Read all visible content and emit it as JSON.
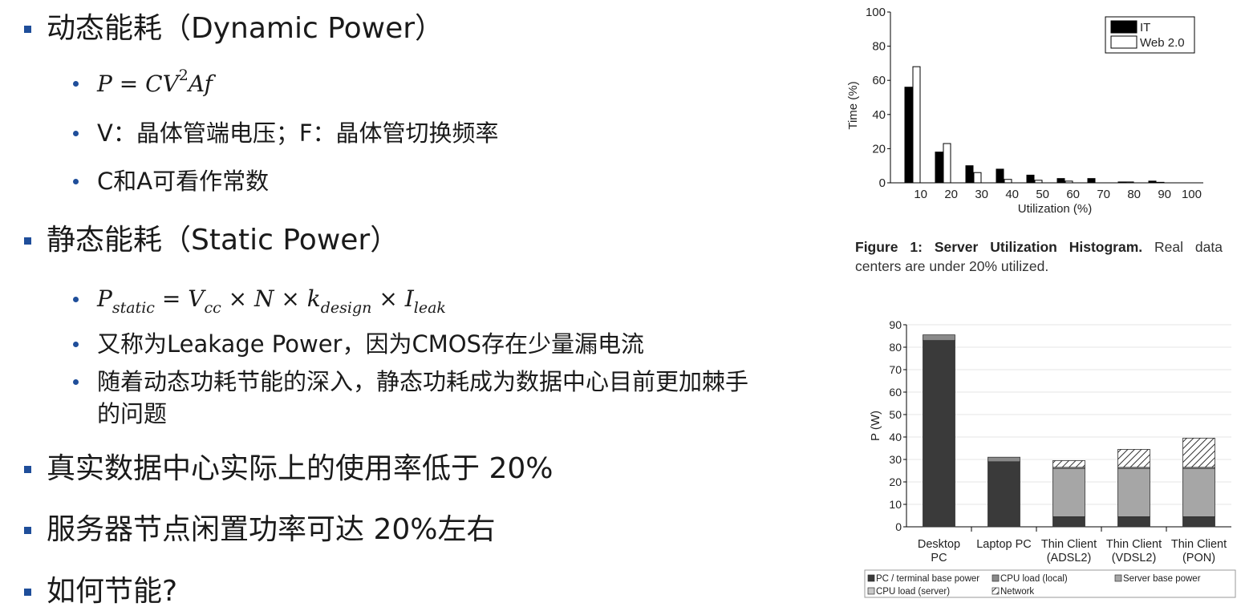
{
  "slide": {
    "items": [
      {
        "level": 1,
        "text": "动态能耗（Dynamic Power）"
      },
      {
        "level": 2,
        "kind": "formula",
        "parts": {
          "p": "P",
          "eq": "=",
          "c": "C",
          "v": "V",
          "exp": "2",
          "a": "A",
          "f": "f"
        }
      },
      {
        "level": 2,
        "text": "V：晶体管端电压；F：晶体管切换频率"
      },
      {
        "level": 2,
        "text": "C和A可看作常数"
      },
      {
        "level": 1,
        "text": "静态能耗（Static Power）"
      },
      {
        "level": 2,
        "kind": "formula",
        "parts": {
          "p": "P",
          "p_sub": "static",
          "eq": "=",
          "v": "V",
          "v_sub": "cc",
          "times": "×",
          "n": "N",
          "k": "k",
          "k_sub": "design",
          "i": "I",
          "i_sub": "leak"
        }
      },
      {
        "level": 2,
        "text": "又称为Leakage Power，因为CMOS存在少量漏电流"
      },
      {
        "level": 2,
        "text": "随着动态功耗节能的深入，静态功耗成为数据中心目前更加棘手",
        "text2": "的问题"
      },
      {
        "level": 1,
        "text": "真实数据中心实际上的使用率低于 20%"
      },
      {
        "level": 1,
        "text": "服务器节点闲置功率可达 20%左右"
      },
      {
        "level": 1,
        "text": "如何节能?"
      }
    ]
  },
  "figure_caption": {
    "label": "Figure 1:",
    "title": "Server Utilization Histogram.",
    "body": "Real data centers are under 20% utilized."
  },
  "colors": {
    "bullet": "#1f4e9a",
    "it": "#000000",
    "web": "#ffffff",
    "pc_base": "#3a3a3a",
    "cpu_local": "#8a8a8a",
    "server_base": "#a6a6a6",
    "cpu_server": "#c8c8c8"
  },
  "chart_data": [
    {
      "type": "bar",
      "categories": [
        "10",
        "20",
        "30",
        "40",
        "50",
        "60",
        "70",
        "80",
        "90",
        "100"
      ],
      "series": [
        {
          "name": "IT",
          "values": [
            56,
            18,
            10,
            8,
            4.5,
            2.5,
            2.5,
            0.5,
            1,
            0
          ]
        },
        {
          "name": "Web 2.0",
          "values": [
            68,
            23,
            6,
            2,
            1.5,
            1,
            0,
            0.5,
            0.3,
            0
          ]
        }
      ],
      "xlabel": "Utilization (%)",
      "ylabel": "Time (%)",
      "ylim": [
        0,
        100
      ],
      "yticks": [
        0,
        20,
        40,
        60,
        80,
        100
      ],
      "legend": "top-right"
    },
    {
      "type": "bar",
      "stacked": true,
      "categories": [
        [
          "Desktop",
          "PC"
        ],
        [
          "Laptop PC"
        ],
        [
          "Thin Client",
          "(ADSL2)"
        ],
        [
          "Thin Client",
          "(VDSL2)"
        ],
        [
          "Thin Client",
          "(PON)"
        ]
      ],
      "series": [
        {
          "name": "PC / terminal base power",
          "values": [
            83,
            29,
            4.5,
            4.5,
            4.5
          ]
        },
        {
          "name": "CPU load (local)",
          "values": [
            2.5,
            2,
            0,
            0,
            0
          ]
        },
        {
          "name": "Server base power",
          "values": [
            0,
            0,
            21.5,
            21.5,
            21.5
          ]
        },
        {
          "name": "CPU load (server)",
          "values": [
            0,
            0,
            0.5,
            0.5,
            0.5
          ]
        },
        {
          "name": "Network",
          "values": [
            0,
            0,
            3,
            8,
            13
          ]
        }
      ],
      "xlabel": "",
      "ylabel": "P (W)",
      "ylim": [
        0,
        90
      ],
      "yticks": [
        0,
        10,
        20,
        30,
        40,
        50,
        60,
        70,
        80,
        90
      ],
      "legend": "bottom"
    }
  ]
}
